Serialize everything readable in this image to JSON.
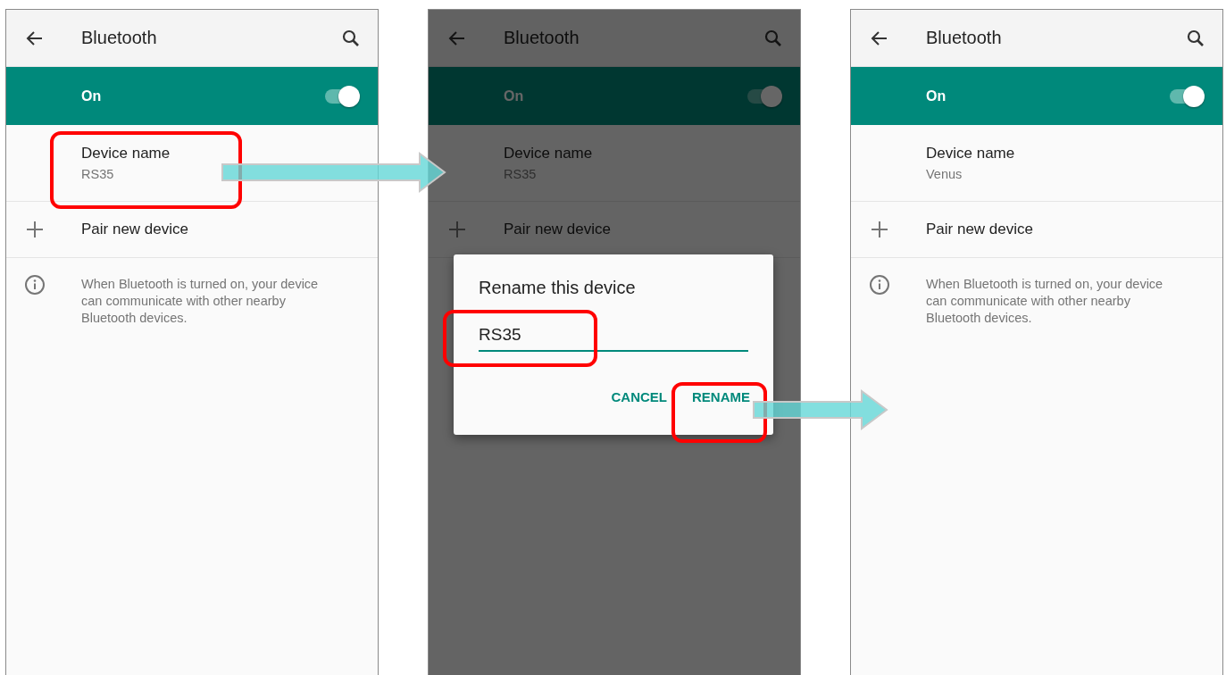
{
  "screens": [
    {
      "title": "Bluetooth",
      "dimmed": false,
      "toggle": {
        "label": "On",
        "on": true
      },
      "device": {
        "title": "Device name",
        "value": "RS35",
        "highlighted": true
      },
      "pair": "Pair new device",
      "info": "When Bluetooth is turned on, your device can communicate with other nearby Bluetooth devices."
    },
    {
      "title": "Bluetooth",
      "dimmed": true,
      "toggle": {
        "label": "On",
        "on": true
      },
      "device": {
        "title": "Device name",
        "value": "RS35",
        "highlighted": false
      },
      "pair": "Pair new device",
      "dialog": {
        "title": "Rename this device",
        "value": "RS35",
        "field_highlighted": true,
        "buttons": [
          {
            "label": "CANCEL",
            "highlighted": false
          },
          {
            "label": "RENAME",
            "highlighted": true
          }
        ]
      }
    },
    {
      "title": "Bluetooth",
      "dimmed": false,
      "toggle": {
        "label": "On",
        "on": true
      },
      "device": {
        "title": "Device name",
        "value": "Venus",
        "highlighted": false
      },
      "pair": "Pair new device",
      "info": "When Bluetooth is turned on, your device can communicate with other nearby Bluetooth devices."
    }
  ]
}
